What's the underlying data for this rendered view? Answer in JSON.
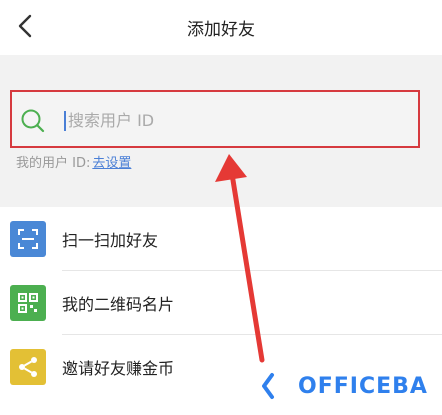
{
  "header": {
    "title": "添加好友",
    "back_icon": "chevron-left-icon"
  },
  "search": {
    "placeholder": "搜索用户 ID",
    "value": "",
    "icon": "search-icon",
    "highlight_color": "#d63a3f"
  },
  "my_id": {
    "label": "我的用户 ID:",
    "link": "去设置",
    "link_color": "#4a7fd6"
  },
  "menu": [
    {
      "label": "扫一扫加好友",
      "icon": "scan-icon",
      "color": "#4a88d6"
    },
    {
      "label": "我的二维码名片",
      "icon": "qr-code-icon",
      "color": "#4caf50"
    },
    {
      "label": "邀请好友赚金币",
      "icon": "share-icon",
      "color": "#e3c035"
    }
  ],
  "annotation": {
    "arrow_color": "#e53935"
  },
  "watermark": {
    "text": "OFFICEBA",
    "color": "#2f80ed"
  }
}
